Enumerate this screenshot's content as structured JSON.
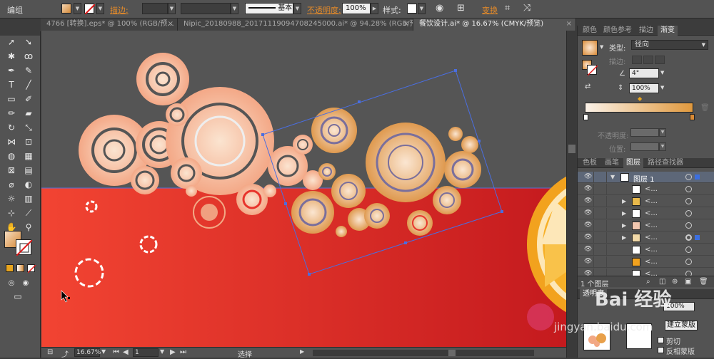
{
  "control_bar": {
    "mode_label": "编组",
    "stroke_label": "描边:",
    "stroke_style": "基本",
    "opacity_label": "不透明度:",
    "opacity_value": "100%",
    "style_label": "样式:",
    "transform_label": "变换"
  },
  "tabs": [
    {
      "label": "4766 [转换].eps* @ 100% (RGB/预..."
    },
    {
      "label": "Nipic_20180988_20171119094708245000.ai* @ 94.28% (RGB/预..."
    },
    {
      "label": "餐饮设计.ai* @ 16.67% (CMYK/预览)"
    }
  ],
  "status_bar": {
    "zoom": "16.67%",
    "artboard": "1",
    "status_text": "选择"
  },
  "panel_top": {
    "tabs": [
      "颜色",
      "颜色参考",
      "描边",
      "渐变"
    ],
    "active_tab": "渐变",
    "type_label": "类型:",
    "type_value": "径向",
    "stroke_label": "描边:",
    "angle_value": "4°",
    "aspect_value": "100%",
    "opacity_label": "不透明度:",
    "position_label": "位置:"
  },
  "panel_bottom": {
    "tabs": [
      "色板",
      "画笔",
      "图层",
      "路径查找器"
    ],
    "active_tab": "图层",
    "layer_name": "图层 1",
    "sublayer_label": "<...",
    "sublayer_count": 8,
    "footer_text": "1 个图层"
  },
  "transparency_panel": {
    "title": "透明度",
    "opacity_value": "100%",
    "mask_button": "建立蒙版",
    "clip_label": "剪切",
    "invert_label": "反相蒙版"
  },
  "watermark": {
    "text": "jingyan.baidu.com",
    "brand": "Bai 经验"
  },
  "colors": {
    "canvas_gray": "#555555",
    "canvas_red": "#e8342c",
    "gradient_light": "#fbe6d2",
    "gradient_dark": "#d98a35",
    "accent_orange": "#e38a2a",
    "selection_blue": "#4a6ee0"
  }
}
